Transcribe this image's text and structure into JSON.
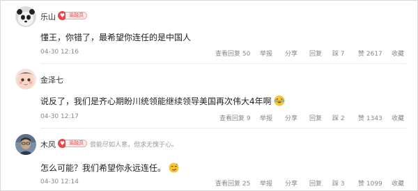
{
  "comments": [
    {
      "user": "乐山",
      "badge": "渝融员",
      "signature": "",
      "text": "懂王，你错了，最希望你连任的是中国人",
      "emoji": "",
      "time": "04-30 12:16",
      "view_replies": "查看回复 50",
      "report": "举报",
      "share": "分享",
      "reply": "回复",
      "step": "踩 7",
      "like": "赞 2617",
      "collapse": "收藏"
    },
    {
      "user": "金泽七",
      "badge": "",
      "signature": "",
      "text": "说反了，我们是齐心期盼川统领能继续领导美国再次伟大4年啊",
      "emoji": "laughing-tears",
      "time": "04-30 12:17",
      "view_replies": "查看回复 9",
      "report": "举报",
      "share": "分享",
      "reply": "回复",
      "step": "踩 2",
      "like": "赞 1343",
      "collapse": "收藏"
    },
    {
      "user": "木风",
      "badge": "渝融员",
      "signature": "尝能尽如人意，但求无愧于心。",
      "text": "怎么可能？我们希望你永远连任。",
      "emoji": "smirk",
      "time": "04-30 12:14",
      "view_replies": "查看回复 25",
      "report": "举报",
      "share": "分享",
      "reply": "回复",
      "step": "踩 3",
      "like": "赞 1099",
      "collapse": "收藏"
    }
  ],
  "colors": {
    "badge": "#e8484c",
    "meta_text": "#888888",
    "divider": "#ececec"
  }
}
